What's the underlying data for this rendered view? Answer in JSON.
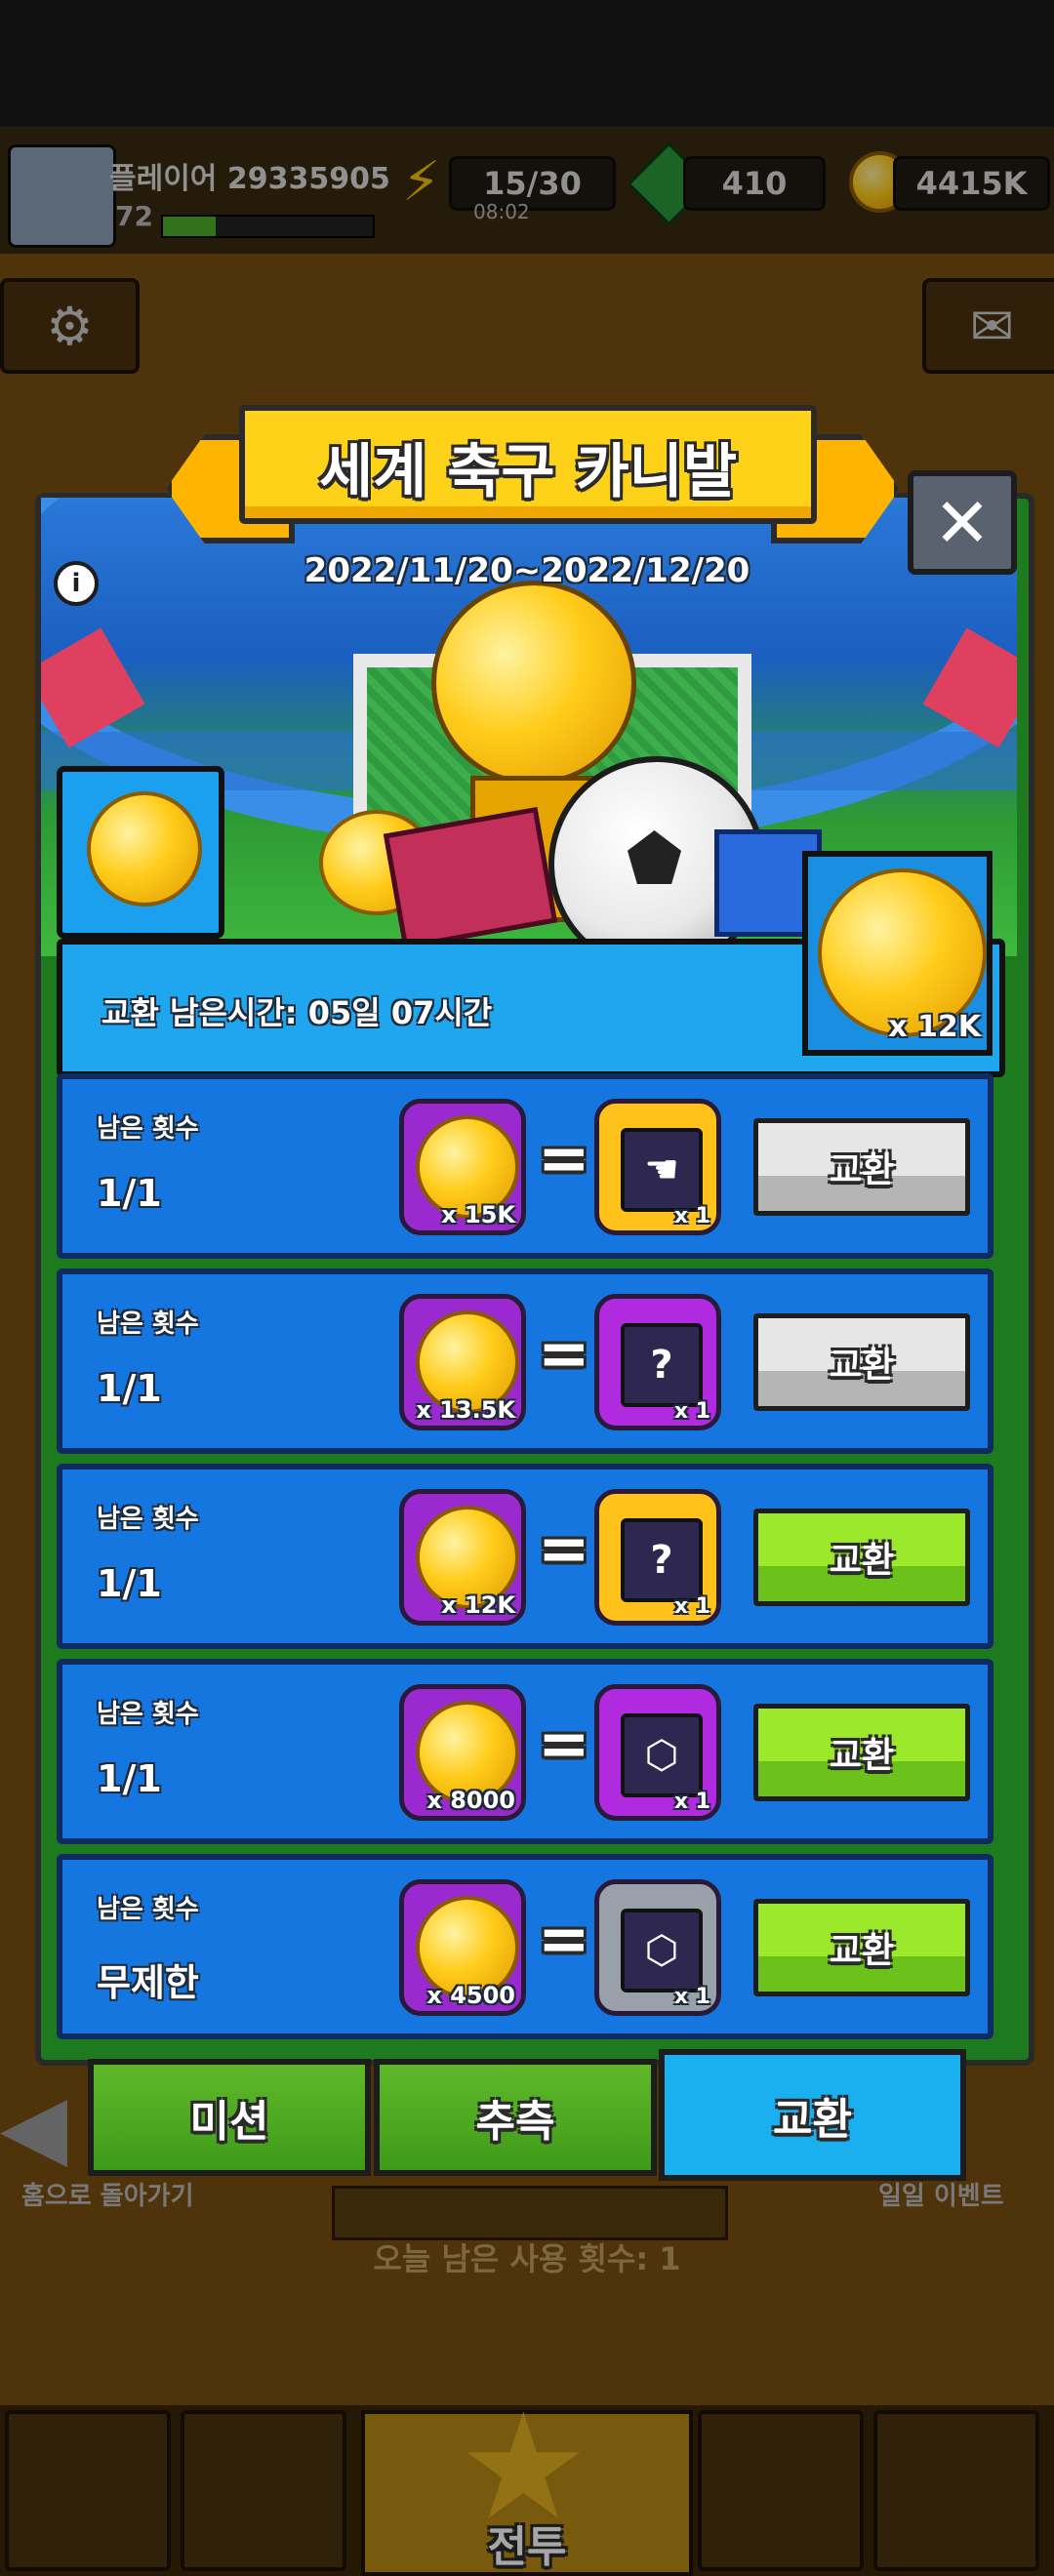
{
  "hud": {
    "player_name": "플레이어 29335905",
    "level": "72",
    "energy": "15/30",
    "energy_timer": "08:02",
    "gems": "410",
    "gold": "4415K"
  },
  "background": {
    "back_label": "홈으로 돌아가기",
    "daily_event_label": "일일 이벤트",
    "remaining_today": "오늘 남은 사용 횟수: 1",
    "battle_label": "전투"
  },
  "popup": {
    "title": "세계 축구 카니발",
    "dates": "2022/11/20~2022/12/20",
    "close_label": "✕",
    "info_icon": "i",
    "time_left": "교환 남은시간: 05일 07시간",
    "owned_coins": "x 12K",
    "remaining_label": "남은 횟수",
    "rows": [
      {
        "remaining": "1/1",
        "cost": "x 15K",
        "reward_qty": "x 1",
        "button": "교환",
        "enabled": false,
        "reward_color": "#ffc21a",
        "reward_icon": "☚"
      },
      {
        "remaining": "1/1",
        "cost": "x 13.5K",
        "reward_qty": "x 1",
        "button": "교환",
        "enabled": false,
        "reward_color": "#b02adf",
        "reward_icon": "?"
      },
      {
        "remaining": "1/1",
        "cost": "x 12K",
        "reward_qty": "x 1",
        "button": "교환",
        "enabled": true,
        "reward_color": "#ffc21a",
        "reward_icon": "?"
      },
      {
        "remaining": "1/1",
        "cost": "x 8000",
        "reward_qty": "x 1",
        "button": "교환",
        "enabled": true,
        "reward_color": "#b02adf",
        "reward_icon": "⬡"
      },
      {
        "remaining": "무제한",
        "cost": "x 4500",
        "reward_qty": "x 1",
        "button": "교환",
        "enabled": true,
        "reward_color": "#9aa0aa",
        "reward_icon": "⬡"
      }
    ],
    "tabs": [
      {
        "label": "미션",
        "active": false
      },
      {
        "label": "추측",
        "active": false
      },
      {
        "label": "교환",
        "active": true
      }
    ]
  }
}
